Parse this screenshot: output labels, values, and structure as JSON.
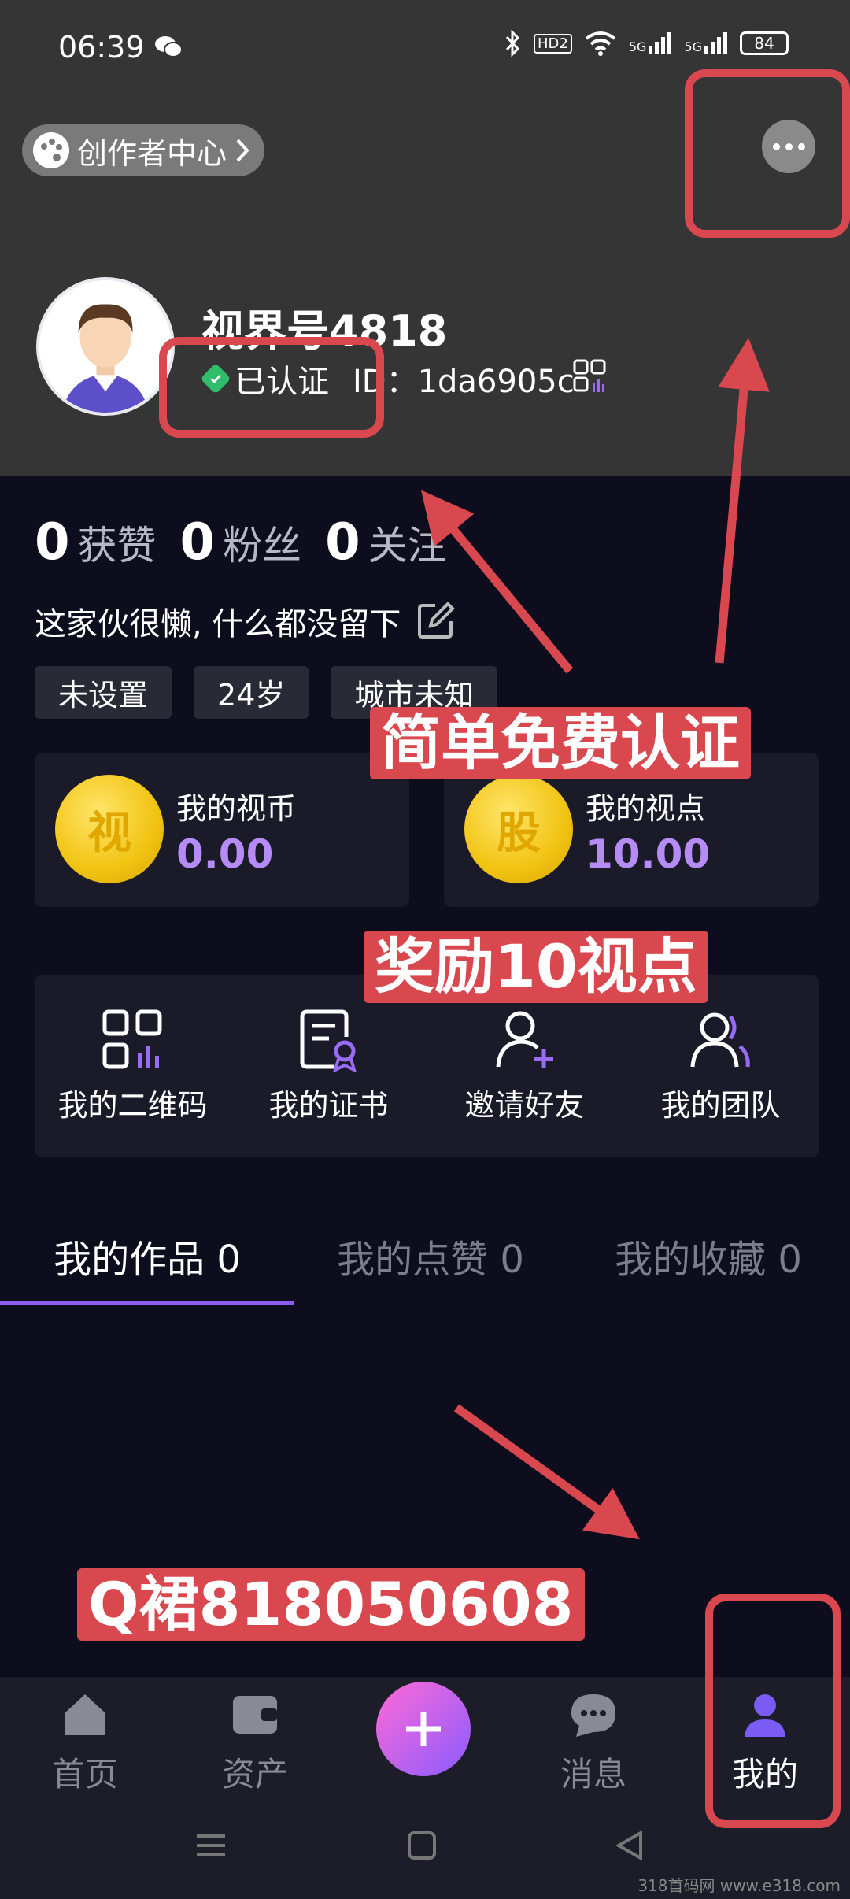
{
  "status_bar": {
    "time": "06:39",
    "hd_label": "HD2",
    "signal1_label": "5G",
    "signal2_label": "5G",
    "battery": "84"
  },
  "header": {
    "creator_center": "创作者中心",
    "username": "视界号4818",
    "verified_label": "已认证",
    "id_label": "ID：1da6905c"
  },
  "stats": [
    {
      "num": "0",
      "label": "获赞"
    },
    {
      "num": "0",
      "label": "粉丝"
    },
    {
      "num": "0",
      "label": "关注"
    }
  ],
  "bio": "这家伙很懒, 什么都没留下",
  "tags": [
    "未设置",
    "24岁",
    "城市未知"
  ],
  "wallet": {
    "coins": {
      "icon_char": "视",
      "title": "我的视币",
      "value": "0.00"
    },
    "points": {
      "icon_char": "股",
      "title": "我的视点",
      "value": "10.00"
    }
  },
  "actions": [
    {
      "label": "我的二维码",
      "icon": "qr-code-icon"
    },
    {
      "label": "我的证书",
      "icon": "certificate-icon"
    },
    {
      "label": "邀请好友",
      "icon": "invite-user-icon"
    },
    {
      "label": "我的团队",
      "icon": "team-icon"
    }
  ],
  "tabs": [
    {
      "label": "我的作品 0",
      "active": true
    },
    {
      "label": "我的点赞 0",
      "active": false
    },
    {
      "label": "我的收藏 0",
      "active": false
    }
  ],
  "bottom_nav": [
    {
      "label": "首页",
      "icon": "home-icon"
    },
    {
      "label": "资产",
      "icon": "wallet-icon"
    },
    {
      "label": "",
      "icon": "plus-icon"
    },
    {
      "label": "消息",
      "icon": "message-icon"
    },
    {
      "label": "我的",
      "icon": "profile-icon"
    }
  ],
  "annotations": {
    "free_verify": "简单免费认证",
    "reward": "奖励10视点",
    "qq_group": "Q裙818050608"
  },
  "watermark": "318首码网 www.e318.com",
  "colors": {
    "header_bg": "#353535",
    "page_bg": "#0d0d1e",
    "card_bg": "#1a1a29",
    "accent_purple": "#b58cf5",
    "annotation_red": "#d9474f",
    "verified_green": "#2fbd6b"
  }
}
